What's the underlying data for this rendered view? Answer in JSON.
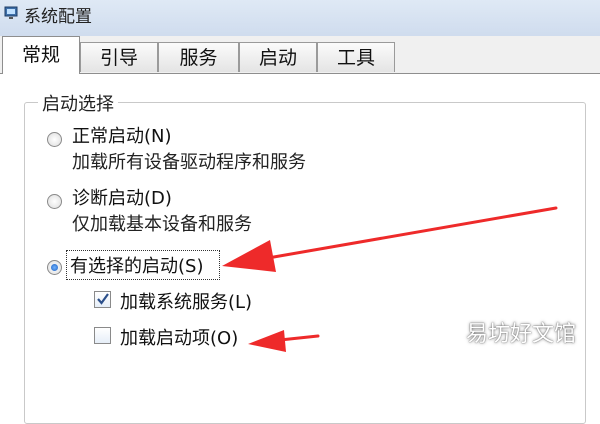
{
  "window": {
    "title": "系统配置"
  },
  "tabs": [
    {
      "label": "常规",
      "active": true
    },
    {
      "label": "引导",
      "active": false
    },
    {
      "label": "服务",
      "active": false
    },
    {
      "label": "启动",
      "active": false
    },
    {
      "label": "工具",
      "active": false
    }
  ],
  "startup": {
    "group_label": "启动选择",
    "normal": {
      "label": "正常启动(N)",
      "desc": "加载所有设备驱动程序和服务",
      "selected": false
    },
    "diagnostic": {
      "label": "诊断启动(D)",
      "desc": "仅加载基本设备和服务",
      "selected": false
    },
    "selective": {
      "label": "有选择的启动(S)",
      "selected": true
    },
    "options": [
      {
        "label": "加载系统服务(L)",
        "checked": true
      },
      {
        "label": "加载启动项(O)",
        "checked": false
      }
    ]
  },
  "annotations": {
    "arrow_color": "#ee2a2a"
  },
  "watermark": "易坊好文馆"
}
